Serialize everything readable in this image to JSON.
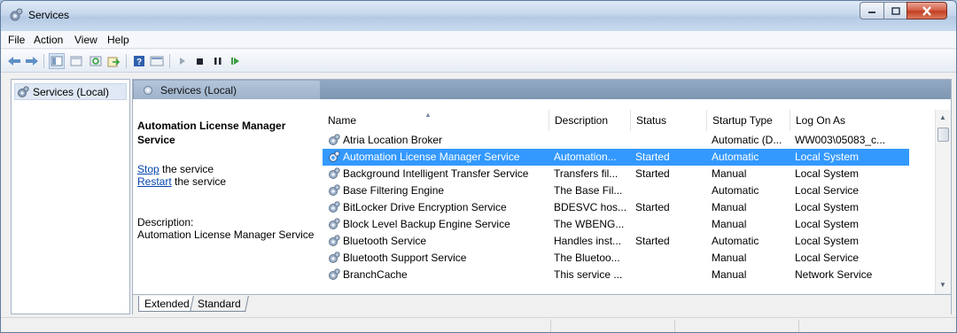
{
  "window": {
    "title": "Services"
  },
  "menu": [
    "File",
    "Action",
    "View",
    "Help"
  ],
  "tree": {
    "item": "Services (Local)"
  },
  "main": {
    "header": "Services (Local)",
    "detail": {
      "title": "Automation License Manager Service",
      "stop_link": "Stop",
      "stop_text": " the service",
      "restart_link": "Restart",
      "restart_text": " the service",
      "desc_label": "Description:",
      "desc_text": "Automation License Manager Service"
    },
    "columns": [
      "Name",
      "Description",
      "Status",
      "Startup Type",
      "Log On As"
    ],
    "rows": [
      {
        "name": "Atria Location Broker",
        "desc": "",
        "status": "",
        "startup": "Automatic (D...",
        "logon": "WW003\\05083_c..."
      },
      {
        "name": "Automation License Manager Service",
        "desc": "Automation...",
        "status": "Started",
        "startup": "Automatic",
        "logon": "Local System"
      },
      {
        "name": "Background Intelligent Transfer Service",
        "desc": "Transfers fil...",
        "status": "Started",
        "startup": "Manual",
        "logon": "Local System"
      },
      {
        "name": "Base Filtering Engine",
        "desc": "The Base Fil...",
        "status": "",
        "startup": "Automatic",
        "logon": "Local Service"
      },
      {
        "name": "BitLocker Drive Encryption Service",
        "desc": "BDESVC hos...",
        "status": "Started",
        "startup": "Manual",
        "logon": "Local System"
      },
      {
        "name": "Block Level Backup Engine Service",
        "desc": "The WBENG...",
        "status": "",
        "startup": "Manual",
        "logon": "Local System"
      },
      {
        "name": "Bluetooth Service",
        "desc": "Handles inst...",
        "status": "Started",
        "startup": "Automatic",
        "logon": "Local System"
      },
      {
        "name": "Bluetooth Support Service",
        "desc": "The Bluetoo...",
        "status": "",
        "startup": "Manual",
        "logon": "Local Service"
      },
      {
        "name": "BranchCache",
        "desc": "This service ...",
        "status": "",
        "startup": "Manual",
        "logon": "Network Service"
      }
    ],
    "tabs": {
      "extended": "Extended",
      "standard": "Standard"
    }
  },
  "colors": {
    "selection": "#3399ff",
    "header": "#8aa1bd",
    "link": "#0645ad"
  }
}
